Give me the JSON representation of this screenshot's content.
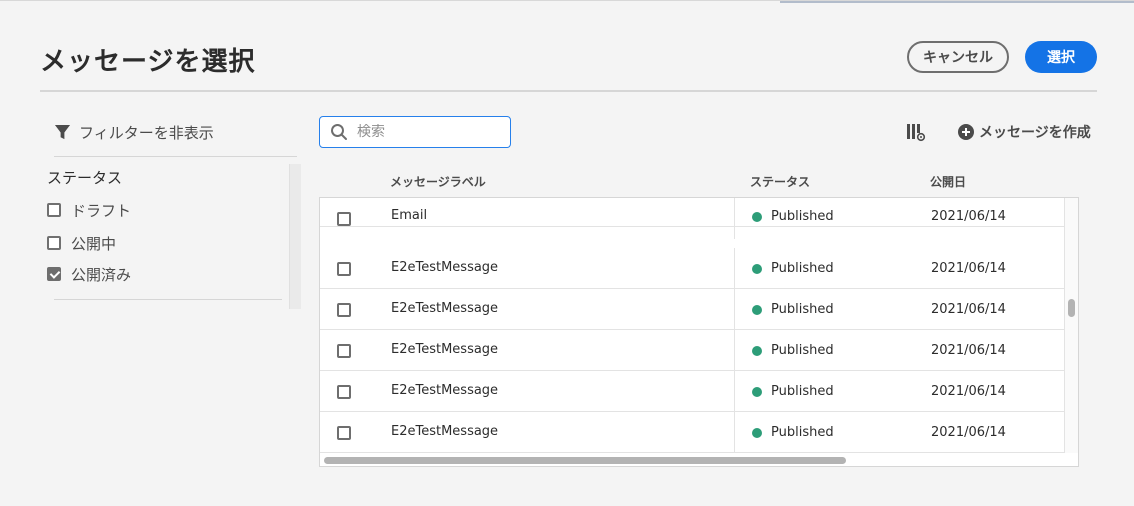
{
  "dialog": {
    "title": "メッセージを選択",
    "cancel_label": "キャンセル",
    "select_label": "選択"
  },
  "filters": {
    "toggle_label": "フィルターを非表示",
    "status_heading": "ステータス",
    "options": [
      {
        "label": "ドラフト",
        "checked": false
      },
      {
        "label": "公開中",
        "checked": false
      },
      {
        "label": "公開済み",
        "checked": true
      }
    ]
  },
  "toolbar": {
    "search_placeholder": "検索",
    "create_label": "メッセージを作成"
  },
  "table": {
    "headers": {
      "label": "メッセージラベル",
      "status": "ステータス",
      "date": "公開日"
    },
    "rows": [
      {
        "label": "Email",
        "status": "Published",
        "date": "2021/06/14"
      },
      {
        "label": "E2eTestMessage",
        "status": "Published",
        "date": "2021/06/14"
      },
      {
        "label": "E2eTestMessage",
        "status": "Published",
        "date": "2021/06/14"
      },
      {
        "label": "E2eTestMessage",
        "status": "Published",
        "date": "2021/06/14"
      },
      {
        "label": "E2eTestMessage",
        "status": "Published",
        "date": "2021/06/14"
      },
      {
        "label": "E2eTestMessage",
        "status": "Published",
        "date": "2021/06/14"
      }
    ]
  },
  "colors": {
    "accent": "#1473e6",
    "published": "#2d9d78"
  }
}
